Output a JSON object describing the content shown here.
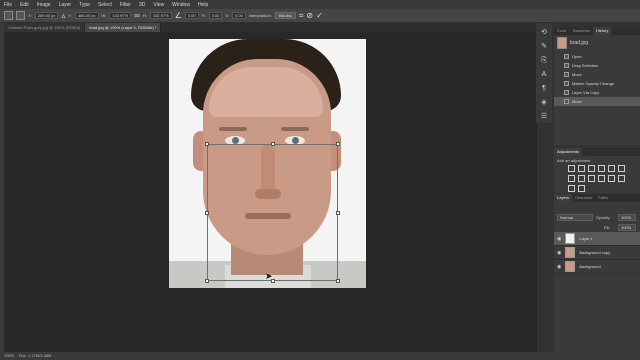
{
  "menu": [
    "File",
    "Edit",
    "Image",
    "Layer",
    "Type",
    "Select",
    "Filter",
    "3D",
    "View",
    "Window",
    "Help"
  ],
  "options": {
    "x_label": "X:",
    "x_value": "269.00 px",
    "y_label": "Y:",
    "y_value": "466.00 px",
    "w_label": "W:",
    "w_value": "102.97%",
    "h_label": "H:",
    "h_value": "102.97%",
    "angle_value": "0.00",
    "hskew_label": "H:",
    "hskew_value": "0.00",
    "vskew_label": "V:",
    "vskew_value": "0.00",
    "interp_label": "Interpolation:",
    "interp_value": "Bicubic"
  },
  "tabs": [
    {
      "label": "Vladimir Putin-grey.jpg @ 100% (RGB/8)"
    },
    {
      "label": "brad.jpg @ 100% (Layer 1, RGB/8#) *"
    }
  ],
  "history": {
    "tabs": [
      "Color",
      "Swatches",
      "History"
    ],
    "snapshot": "brad.jpg",
    "items": [
      "Open",
      "Drag Selection",
      "Move",
      "Master Opacity Change",
      "Layer Via Copy",
      "Move"
    ]
  },
  "adjustments": {
    "title": "Adjustments",
    "subtitle": "Add an adjustment"
  },
  "layers": {
    "tabs": [
      "Layers",
      "Channels",
      "Paths"
    ],
    "blend_mode": "Normal",
    "opacity_label": "Opacity:",
    "opacity_value": "100%",
    "fill_label": "Fill:",
    "fill_value": "100%",
    "rows": [
      {
        "name": "Layer 1"
      },
      {
        "name": "Background copy"
      },
      {
        "name": "Background"
      }
    ]
  },
  "status": {
    "zoom": "100%",
    "doc": "Doc: 1.17M/3.38M"
  }
}
